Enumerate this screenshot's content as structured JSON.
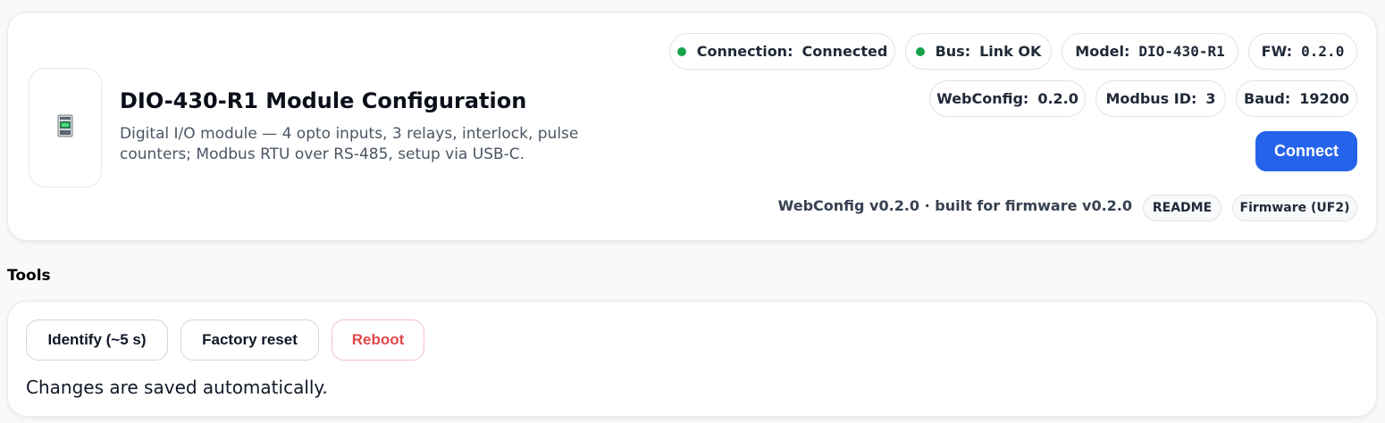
{
  "header": {
    "title": "DIO-430-R1 Module Configuration",
    "subtitle": "Digital I/O module — 4 opto inputs, 3 relays, interlock, pulse counters; Modbus RTU over RS-485, setup via USB-C.",
    "device_icon": "dio-module-icon"
  },
  "status": {
    "connection": {
      "label": "Connection:",
      "value": "Connected",
      "color": "#16a34a"
    },
    "bus": {
      "label": "Bus:",
      "value": "Link OK",
      "color": "#16a34a"
    },
    "model": {
      "label": "Model:",
      "value": "DIO-430-R1"
    },
    "fw": {
      "label": "FW:",
      "value": "0.2.0"
    },
    "webconfig": {
      "label": "WebConfig:",
      "value": "0.2.0"
    },
    "modbus_id": {
      "label": "Modbus ID:",
      "value": "3"
    },
    "baud": {
      "label": "Baud:",
      "value": "19200"
    }
  },
  "actions": {
    "connect_label": "Connect",
    "accent": "#2563eb"
  },
  "footer": {
    "version_text": "WebConfig v0.2.0 · built for firmware v0.2.0",
    "readme_label": "README",
    "firmware_label": "Firmware (UF2)"
  },
  "tools": {
    "section_title": "Tools",
    "identify_label": "Identify (~5 s)",
    "factory_reset_label": "Factory reset",
    "reboot_label": "Reboot",
    "reboot_color": "#e04848",
    "note": "Changes are saved automatically."
  }
}
